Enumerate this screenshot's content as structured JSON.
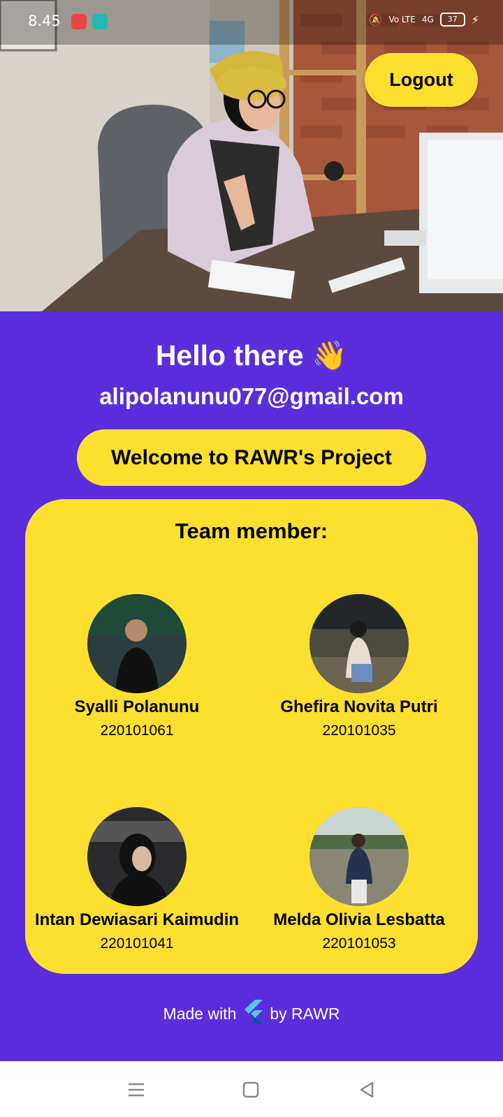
{
  "status_bar": {
    "time": "8.45",
    "network": "Vo LTE",
    "signal": "4G",
    "battery": "37"
  },
  "header": {
    "logout_label": "Logout"
  },
  "greeting": {
    "hello": "Hello there 👋",
    "email": "alipolanunu077@gmail.com",
    "welcome_label": "Welcome to RAWR's Project"
  },
  "team": {
    "title": "Team member:",
    "members": [
      {
        "name": "Syalli Polanunu",
        "id": "220101061"
      },
      {
        "name": "Ghefira Novita Putri",
        "id": "220101035"
      },
      {
        "name": "Intan Dewiasari Kaimudin",
        "id": "220101041"
      },
      {
        "name": "Melda Olivia Lesbatta",
        "id": "220101053"
      }
    ]
  },
  "footer": {
    "made_with": "Made with",
    "by": "by RAWR"
  },
  "colors": {
    "primary_purple": "#5b2ddd",
    "accent_yellow": "#fde02f"
  }
}
